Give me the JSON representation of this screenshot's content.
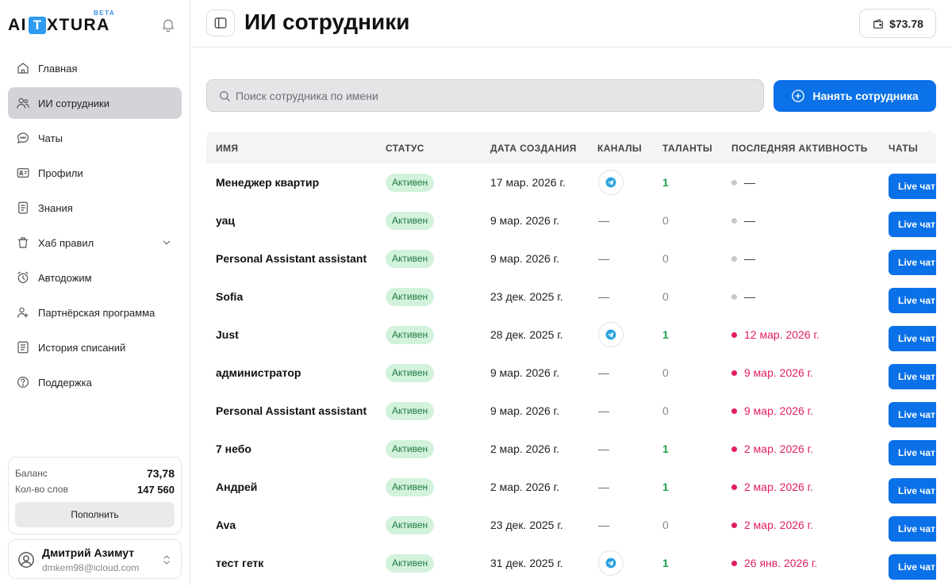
{
  "brand": {
    "logo_left": "AI",
    "logo_t": "T",
    "logo_right": "XTURA",
    "beta": "BETA"
  },
  "sidebar": {
    "items": [
      {
        "label": "Главная",
        "icon": "home-icon"
      },
      {
        "label": "ИИ сотрудники",
        "icon": "users-icon",
        "active": true
      },
      {
        "label": "Чаты",
        "icon": "chat-icon"
      },
      {
        "label": "Профили",
        "icon": "profile-card-icon"
      },
      {
        "label": "Знания",
        "icon": "document-icon"
      },
      {
        "label": "Хаб правил",
        "icon": "trash-rules-icon",
        "has_chevron": true
      },
      {
        "label": "Автодожим",
        "icon": "alarm-clock-icon"
      },
      {
        "label": "Партнёрская программа",
        "icon": "partner-icon"
      },
      {
        "label": "История списаний",
        "icon": "list-icon"
      },
      {
        "label": "Поддержка",
        "icon": "help-icon"
      }
    ],
    "balance": {
      "balance_label": "Баланс",
      "balance_value": "73,78",
      "words_label": "Кол-во слов",
      "words_value": "147 560",
      "topup_label": "Пополнить"
    },
    "user": {
      "name": "Дмитрий Азимут",
      "email": "dmkem98@icloud.com"
    }
  },
  "header": {
    "title": "ИИ сотрудники",
    "wallet": "$73.78"
  },
  "toolbar": {
    "search_placeholder": "Поиск сотрудника по имени",
    "hire_label": "Нанять сотрудника"
  },
  "colors": {
    "accent": "#0b71e8",
    "active_badge_bg": "#d2f2dc",
    "recent_activity": "#e11d62",
    "talent_positive": "#1aa34a"
  },
  "table": {
    "headers": {
      "name": "ИМЯ",
      "status": "СТАТУС",
      "created": "ДАТА СОЗДАНИЯ",
      "channels": "КАНАЛЫ",
      "talents": "ТАЛАНТЫ",
      "activity": "ПОСЛЕДНЯЯ АКТИВНОСТЬ",
      "chats": "ЧАТЫ"
    },
    "rows": [
      {
        "name": "Менеджер квартир",
        "status": "Активен",
        "created": "17 мар. 2026 г.",
        "channel": "telegram",
        "talents": "1",
        "activity": "—",
        "activity_state": "gray",
        "chat": "Live чат"
      },
      {
        "name": "уац",
        "status": "Активен",
        "created": "9 мар. 2026 г.",
        "channel": "—",
        "talents": "0",
        "activity": "—",
        "activity_state": "gray",
        "chat": "Live чат"
      },
      {
        "name": "Personal Assistant assistant",
        "status": "Активен",
        "created": "9 мар. 2026 г.",
        "channel": "—",
        "talents": "0",
        "activity": "—",
        "activity_state": "gray",
        "chat": "Live чат"
      },
      {
        "name": "Sofia",
        "status": "Активен",
        "created": "23 дек. 2025 г.",
        "channel": "—",
        "talents": "0",
        "activity": "—",
        "activity_state": "gray",
        "chat": "Live чат"
      },
      {
        "name": "Just",
        "status": "Активен",
        "created": "28 дек. 2025 г.",
        "channel": "telegram",
        "talents": "1",
        "activity": "12 мар. 2026 г.",
        "activity_state": "red",
        "chat": "Live чат"
      },
      {
        "name": "администратор",
        "status": "Активен",
        "created": "9 мар. 2026 г.",
        "channel": "—",
        "talents": "0",
        "activity": "9 мар. 2026 г.",
        "activity_state": "red",
        "chat": "Live чат"
      },
      {
        "name": "Personal Assistant assistant",
        "status": "Активен",
        "created": "9 мар. 2026 г.",
        "channel": "—",
        "talents": "0",
        "activity": "9 мар. 2026 г.",
        "activity_state": "red",
        "chat": "Live чат"
      },
      {
        "name": "7 небо",
        "status": "Активен",
        "created": "2 мар. 2026 г.",
        "channel": "—",
        "talents": "1",
        "activity": "2 мар. 2026 г.",
        "activity_state": "red",
        "chat": "Live чат"
      },
      {
        "name": "Андрей",
        "status": "Активен",
        "created": "2 мар. 2026 г.",
        "channel": "—",
        "talents": "1",
        "activity": "2 мар. 2026 г.",
        "activity_state": "red",
        "chat": "Live чат"
      },
      {
        "name": "Ava",
        "status": "Активен",
        "created": "23 дек. 2025 г.",
        "channel": "—",
        "talents": "0",
        "activity": "2 мар. 2026 г.",
        "activity_state": "red",
        "chat": "Live чат"
      },
      {
        "name": "тест гетк",
        "status": "Активен",
        "created": "31 дек. 2025 г.",
        "channel": "telegram",
        "talents": "1",
        "activity": "26 янв. 2026 г.",
        "activity_state": "red",
        "chat": "Live чат"
      }
    ]
  }
}
